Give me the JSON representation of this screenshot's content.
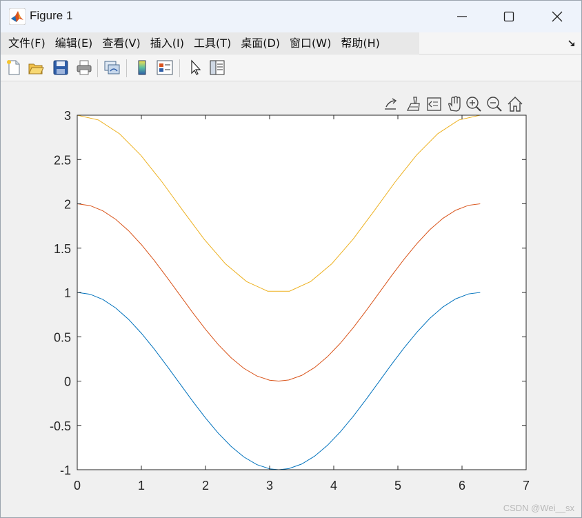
{
  "window": {
    "title": "Figure 1",
    "minimize_label": "minimize",
    "maximize_label": "maximize",
    "close_label": "close"
  },
  "menu": {
    "items": [
      "文件(F)",
      "编辑(E)",
      "查看(V)",
      "插入(I)",
      "工具(T)",
      "桌面(D)",
      "窗口(W)",
      "帮助(H)"
    ]
  },
  "toolbar": {
    "buttons": [
      "new-figure-icon",
      "open-file-icon",
      "save-icon",
      "print-icon",
      "link-plot-icon",
      "colorbar-icon",
      "legend-icon",
      "pointer-icon",
      "property-inspector-icon"
    ]
  },
  "axes_toolbar": {
    "buttons": [
      "export-icon",
      "brush-icon",
      "data-tips-icon",
      "pan-icon",
      "zoom-in-icon",
      "zoom-out-icon",
      "home-icon"
    ]
  },
  "colors": {
    "series1": "#0072BD",
    "series2": "#D95319",
    "series3": "#EDB120"
  },
  "chart_data": {
    "type": "line",
    "title": "",
    "xlabel": "",
    "ylabel": "",
    "xlim": [
      0,
      7
    ],
    "ylim": [
      -1,
      3
    ],
    "xticks": [
      "0",
      "1",
      "2",
      "3",
      "4",
      "5",
      "6",
      "7"
    ],
    "yticks": [
      "-1",
      "-0.5",
      "0",
      "0.5",
      "1",
      "1.5",
      "2",
      "2.5",
      "3"
    ],
    "grid": false,
    "series": [
      {
        "x": [
          0,
          0.2,
          0.4,
          0.6,
          0.8,
          1.0,
          1.2,
          1.4,
          1.6,
          1.8,
          2.0,
          2.2,
          2.4,
          2.6,
          2.8,
          3.0,
          3.1416,
          3.3,
          3.5,
          3.7,
          3.9,
          4.1,
          4.3,
          4.5,
          4.7,
          4.9,
          5.1,
          5.3,
          5.5,
          5.7,
          5.9,
          6.1,
          6.2832
        ],
        "y": [
          1.0,
          0.98,
          0.921,
          0.825,
          0.697,
          0.54,
          0.362,
          0.17,
          -0.029,
          -0.227,
          -0.416,
          -0.589,
          -0.737,
          -0.857,
          -0.942,
          -0.99,
          -1.0,
          -0.987,
          -0.936,
          -0.848,
          -0.726,
          -0.575,
          -0.401,
          -0.211,
          -0.012,
          0.187,
          0.378,
          0.554,
          0.709,
          0.835,
          0.927,
          0.983,
          1.0
        ]
      },
      {
        "x": [
          0,
          0.2,
          0.4,
          0.6,
          0.8,
          1.0,
          1.2,
          1.4,
          1.6,
          1.8,
          2.0,
          2.2,
          2.4,
          2.6,
          2.8,
          3.0,
          3.1416,
          3.3,
          3.5,
          3.7,
          3.9,
          4.1,
          4.3,
          4.5,
          4.7,
          4.9,
          5.1,
          5.3,
          5.5,
          5.7,
          5.9,
          6.1,
          6.2832
        ],
        "y": [
          2.0,
          1.98,
          1.921,
          1.825,
          1.697,
          1.54,
          1.362,
          1.17,
          0.971,
          0.773,
          0.584,
          0.411,
          0.263,
          0.143,
          0.058,
          0.01,
          0.0,
          0.013,
          0.064,
          0.152,
          0.274,
          0.425,
          0.599,
          0.789,
          0.988,
          1.187,
          1.378,
          1.554,
          1.709,
          1.835,
          1.927,
          1.983,
          2.0
        ]
      },
      {
        "x": [
          0,
          0.33,
          0.66,
          0.99,
          1.32,
          1.65,
          1.98,
          2.31,
          2.64,
          2.97,
          3.31,
          3.64,
          3.97,
          4.3,
          4.63,
          4.96,
          5.29,
          5.62,
          5.95,
          6.2832
        ],
        "y": [
          3.0,
          2.946,
          2.79,
          2.549,
          2.249,
          1.921,
          1.6,
          1.324,
          1.123,
          1.014,
          1.014,
          1.123,
          1.324,
          1.6,
          1.921,
          2.249,
          2.549,
          2.79,
          2.946,
          3.0
        ]
      }
    ]
  },
  "watermark": "CSDN @Wei__sx"
}
